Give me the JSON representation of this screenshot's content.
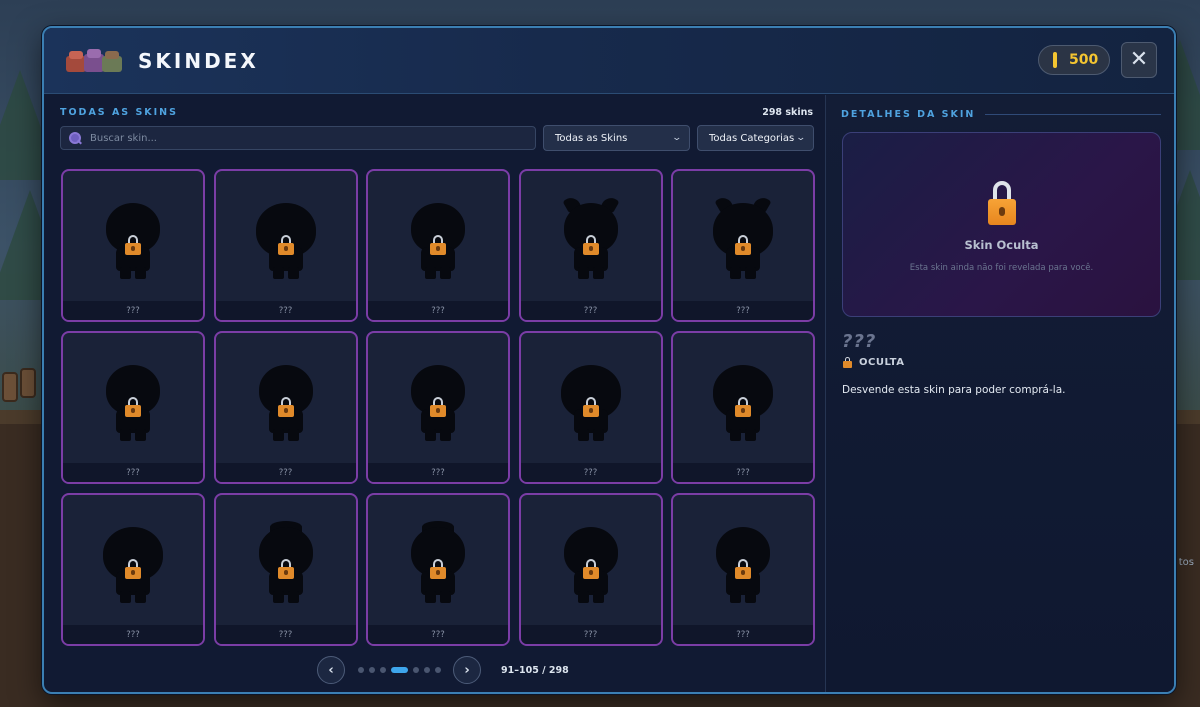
{
  "window": {
    "title": "SKINDEX",
    "coins": "500",
    "close_label": "✕",
    "background_hint": "tos"
  },
  "colors": {
    "accent": "#3ea6ec",
    "card_border": "#7b3da6",
    "coin": "#f4c531",
    "lock": "#e08a2a"
  },
  "browser": {
    "section_label": "TODAS AS SKINS",
    "total_count": "298 skins",
    "search": {
      "placeholder": "Buscar skin...",
      "value": ""
    },
    "filter_skins": {
      "selected": "Todas as Skins"
    },
    "filter_categories": {
      "selected": "Todas Categorias"
    },
    "cards": [
      {
        "name": "???",
        "variant": "round"
      },
      {
        "name": "???",
        "variant": "wide"
      },
      {
        "name": "???",
        "variant": "round"
      },
      {
        "name": "???",
        "variant": "horns"
      },
      {
        "name": "???",
        "variant": "horns-wide"
      },
      {
        "name": "???",
        "variant": "round"
      },
      {
        "name": "???",
        "variant": "round"
      },
      {
        "name": "???",
        "variant": "round"
      },
      {
        "name": "???",
        "variant": "wide"
      },
      {
        "name": "???",
        "variant": "wide"
      },
      {
        "name": "???",
        "variant": "wide"
      },
      {
        "name": "???",
        "variant": "tuft"
      },
      {
        "name": "???",
        "variant": "tuft"
      },
      {
        "name": "???",
        "variant": "round"
      },
      {
        "name": "???",
        "variant": "round"
      }
    ],
    "pagination": {
      "prev_label": "‹",
      "next_label": "›",
      "page_count": 7,
      "active_page": 4,
      "range_text": "91–105 / 298"
    }
  },
  "details": {
    "section_label": "DETALHES DA SKIN",
    "preview_title": "Skin Oculta",
    "preview_subtitle": "Esta skin ainda não foi revelada para você.",
    "name": "???",
    "status": "OCULTA",
    "description": "Desvende esta skin para poder comprá-la."
  }
}
